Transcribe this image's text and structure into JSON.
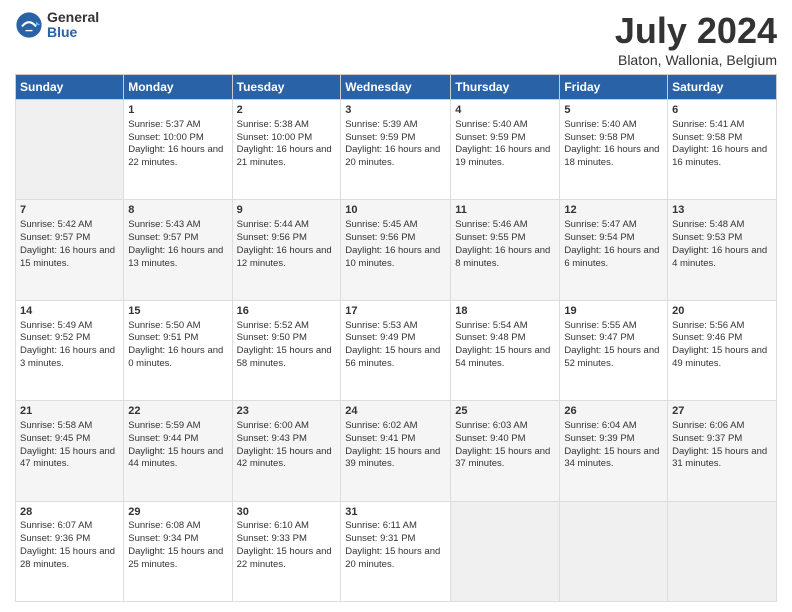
{
  "header": {
    "logo_general": "General",
    "logo_blue": "Blue",
    "month_title": "July 2024",
    "location": "Blaton, Wallonia, Belgium"
  },
  "days_of_week": [
    "Sunday",
    "Monday",
    "Tuesday",
    "Wednesday",
    "Thursday",
    "Friday",
    "Saturday"
  ],
  "weeks": [
    [
      {
        "day": "",
        "empty": true
      },
      {
        "day": "1",
        "sunrise": "Sunrise: 5:37 AM",
        "sunset": "Sunset: 10:00 PM",
        "daylight": "Daylight: 16 hours and 22 minutes."
      },
      {
        "day": "2",
        "sunrise": "Sunrise: 5:38 AM",
        "sunset": "Sunset: 10:00 PM",
        "daylight": "Daylight: 16 hours and 21 minutes."
      },
      {
        "day": "3",
        "sunrise": "Sunrise: 5:39 AM",
        "sunset": "Sunset: 9:59 PM",
        "daylight": "Daylight: 16 hours and 20 minutes."
      },
      {
        "day": "4",
        "sunrise": "Sunrise: 5:40 AM",
        "sunset": "Sunset: 9:59 PM",
        "daylight": "Daylight: 16 hours and 19 minutes."
      },
      {
        "day": "5",
        "sunrise": "Sunrise: 5:40 AM",
        "sunset": "Sunset: 9:58 PM",
        "daylight": "Daylight: 16 hours and 18 minutes."
      },
      {
        "day": "6",
        "sunrise": "Sunrise: 5:41 AM",
        "sunset": "Sunset: 9:58 PM",
        "daylight": "Daylight: 16 hours and 16 minutes."
      }
    ],
    [
      {
        "day": "7",
        "sunrise": "Sunrise: 5:42 AM",
        "sunset": "Sunset: 9:57 PM",
        "daylight": "Daylight: 16 hours and 15 minutes."
      },
      {
        "day": "8",
        "sunrise": "Sunrise: 5:43 AM",
        "sunset": "Sunset: 9:57 PM",
        "daylight": "Daylight: 16 hours and 13 minutes."
      },
      {
        "day": "9",
        "sunrise": "Sunrise: 5:44 AM",
        "sunset": "Sunset: 9:56 PM",
        "daylight": "Daylight: 16 hours and 12 minutes."
      },
      {
        "day": "10",
        "sunrise": "Sunrise: 5:45 AM",
        "sunset": "Sunset: 9:56 PM",
        "daylight": "Daylight: 16 hours and 10 minutes."
      },
      {
        "day": "11",
        "sunrise": "Sunrise: 5:46 AM",
        "sunset": "Sunset: 9:55 PM",
        "daylight": "Daylight: 16 hours and 8 minutes."
      },
      {
        "day": "12",
        "sunrise": "Sunrise: 5:47 AM",
        "sunset": "Sunset: 9:54 PM",
        "daylight": "Daylight: 16 hours and 6 minutes."
      },
      {
        "day": "13",
        "sunrise": "Sunrise: 5:48 AM",
        "sunset": "Sunset: 9:53 PM",
        "daylight": "Daylight: 16 hours and 4 minutes."
      }
    ],
    [
      {
        "day": "14",
        "sunrise": "Sunrise: 5:49 AM",
        "sunset": "Sunset: 9:52 PM",
        "daylight": "Daylight: 16 hours and 3 minutes."
      },
      {
        "day": "15",
        "sunrise": "Sunrise: 5:50 AM",
        "sunset": "Sunset: 9:51 PM",
        "daylight": "Daylight: 16 hours and 0 minutes."
      },
      {
        "day": "16",
        "sunrise": "Sunrise: 5:52 AM",
        "sunset": "Sunset: 9:50 PM",
        "daylight": "Daylight: 15 hours and 58 minutes."
      },
      {
        "day": "17",
        "sunrise": "Sunrise: 5:53 AM",
        "sunset": "Sunset: 9:49 PM",
        "daylight": "Daylight: 15 hours and 56 minutes."
      },
      {
        "day": "18",
        "sunrise": "Sunrise: 5:54 AM",
        "sunset": "Sunset: 9:48 PM",
        "daylight": "Daylight: 15 hours and 54 minutes."
      },
      {
        "day": "19",
        "sunrise": "Sunrise: 5:55 AM",
        "sunset": "Sunset: 9:47 PM",
        "daylight": "Daylight: 15 hours and 52 minutes."
      },
      {
        "day": "20",
        "sunrise": "Sunrise: 5:56 AM",
        "sunset": "Sunset: 9:46 PM",
        "daylight": "Daylight: 15 hours and 49 minutes."
      }
    ],
    [
      {
        "day": "21",
        "sunrise": "Sunrise: 5:58 AM",
        "sunset": "Sunset: 9:45 PM",
        "daylight": "Daylight: 15 hours and 47 minutes."
      },
      {
        "day": "22",
        "sunrise": "Sunrise: 5:59 AM",
        "sunset": "Sunset: 9:44 PM",
        "daylight": "Daylight: 15 hours and 44 minutes."
      },
      {
        "day": "23",
        "sunrise": "Sunrise: 6:00 AM",
        "sunset": "Sunset: 9:43 PM",
        "daylight": "Daylight: 15 hours and 42 minutes."
      },
      {
        "day": "24",
        "sunrise": "Sunrise: 6:02 AM",
        "sunset": "Sunset: 9:41 PM",
        "daylight": "Daylight: 15 hours and 39 minutes."
      },
      {
        "day": "25",
        "sunrise": "Sunrise: 6:03 AM",
        "sunset": "Sunset: 9:40 PM",
        "daylight": "Daylight: 15 hours and 37 minutes."
      },
      {
        "day": "26",
        "sunrise": "Sunrise: 6:04 AM",
        "sunset": "Sunset: 9:39 PM",
        "daylight": "Daylight: 15 hours and 34 minutes."
      },
      {
        "day": "27",
        "sunrise": "Sunrise: 6:06 AM",
        "sunset": "Sunset: 9:37 PM",
        "daylight": "Daylight: 15 hours and 31 minutes."
      }
    ],
    [
      {
        "day": "28",
        "sunrise": "Sunrise: 6:07 AM",
        "sunset": "Sunset: 9:36 PM",
        "daylight": "Daylight: 15 hours and 28 minutes."
      },
      {
        "day": "29",
        "sunrise": "Sunrise: 6:08 AM",
        "sunset": "Sunset: 9:34 PM",
        "daylight": "Daylight: 15 hours and 25 minutes."
      },
      {
        "day": "30",
        "sunrise": "Sunrise: 6:10 AM",
        "sunset": "Sunset: 9:33 PM",
        "daylight": "Daylight: 15 hours and 22 minutes."
      },
      {
        "day": "31",
        "sunrise": "Sunrise: 6:11 AM",
        "sunset": "Sunset: 9:31 PM",
        "daylight": "Daylight: 15 hours and 20 minutes."
      },
      {
        "day": "",
        "empty": true
      },
      {
        "day": "",
        "empty": true
      },
      {
        "day": "",
        "empty": true
      }
    ]
  ]
}
